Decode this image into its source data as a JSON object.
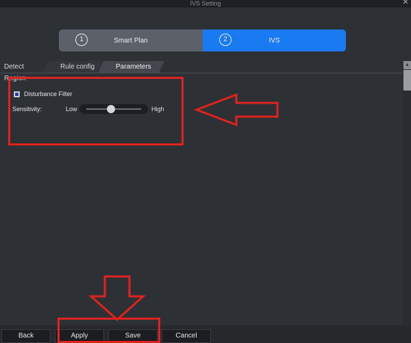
{
  "window": {
    "title": "IVS Setting",
    "close_glyph": "×"
  },
  "wizard": {
    "steps": [
      {
        "number": "1",
        "label": "Smart Plan"
      },
      {
        "number": "2",
        "label": "IVS"
      }
    ]
  },
  "tabs": [
    {
      "label": "Detect Region"
    },
    {
      "label": "Rule config"
    },
    {
      "label": "Parameters"
    }
  ],
  "parameters": {
    "disturbance_filter": {
      "label": "Disturbance Filter",
      "checked": true
    },
    "sensitivity": {
      "label": "Sensitivity:",
      "low": "Low",
      "high": "High",
      "level": 0.45
    }
  },
  "buttons": {
    "back": "Back",
    "apply": "Apply",
    "save": "Save",
    "cancel": "Cancel"
  },
  "colors": {
    "background": "#2d3035",
    "active_step": "#1a7af2",
    "inactive_step": "#5c6068",
    "annotation": "#e3221f"
  }
}
